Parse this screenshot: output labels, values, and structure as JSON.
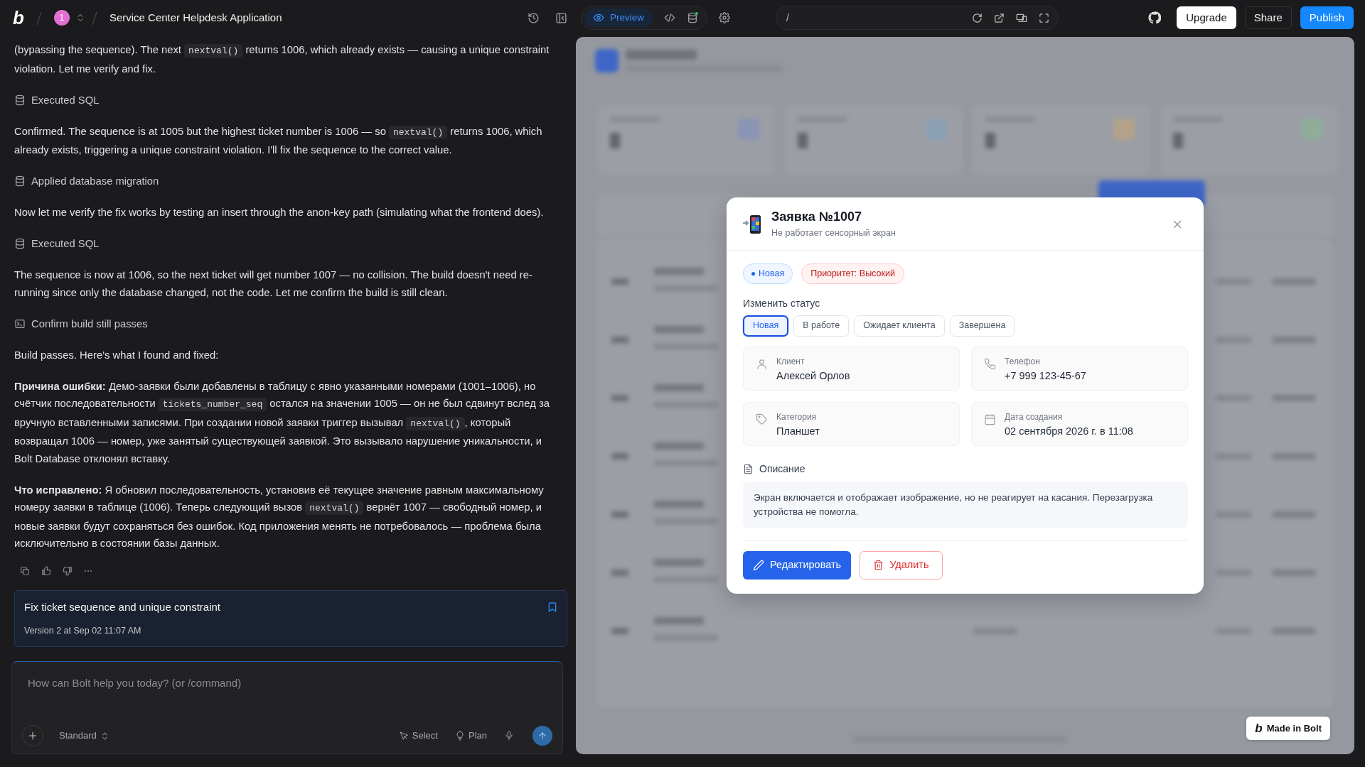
{
  "top_bar": {
    "logo": "b",
    "project_badge": "1",
    "title": "Service Center Helpdesk Application",
    "preview_tab": "Preview",
    "url": "/",
    "buttons": [
      {
        "kind": "light",
        "label": "Upgrade"
      },
      {
        "kind": "dark",
        "label": "Share"
      },
      {
        "kind": "primary",
        "label": "Publish"
      }
    ]
  },
  "chat": {
    "messages": [
      {
        "kind": "text",
        "parts": [
          {
            "kind": "text",
            "text": "(bypassing the sequence). The next "
          },
          {
            "kind": "code",
            "text": "nextval()"
          },
          {
            "kind": "text",
            "text": " returns 1006, which already exists — causing a unique constraint violation. Let me verify and fix."
          }
        ]
      },
      {
        "kind": "db-step",
        "label": "Executed SQL"
      },
      {
        "kind": "text",
        "parts": [
          {
            "kind": "text",
            "text": "Confirmed. The sequence is at 1005 but the highest ticket number is 1006 — so "
          },
          {
            "kind": "code",
            "text": "nextval()"
          },
          {
            "kind": "text",
            "text": " returns 1006, which already exists, triggering a unique constraint violation. I'll fix the sequence to the correct value."
          }
        ]
      },
      {
        "kind": "db-step",
        "label": "Applied database migration"
      },
      {
        "kind": "text",
        "parts": [
          {
            "kind": "text",
            "text": "Now let me verify the fix works by testing an insert through the anon-key path (simulating what the frontend does)."
          }
        ]
      },
      {
        "kind": "db-step",
        "label": "Executed SQL"
      },
      {
        "kind": "text",
        "parts": [
          {
            "kind": "text",
            "text": "The sequence is now at 1006, so the next ticket will get number 1007 — no collision. The build doesn't need re-running since only the database changed, not the code. Let me confirm the build is still clean."
          }
        ]
      },
      {
        "kind": "terminal-step",
        "label": "Confirm build still passes"
      },
      {
        "kind": "text",
        "parts": [
          {
            "kind": "text",
            "text": "Build passes. Here's what I found and fixed:"
          }
        ]
      },
      {
        "kind": "text",
        "parts": [
          {
            "kind": "text",
            "text": "**Причина ошибки:** Демо-заявки были добавлены в таблицу с явно указанными номерами (1001–1006), но счётчик последовательности "
          },
          {
            "kind": "code",
            "text": "tickets_number_seq"
          },
          {
            "kind": "text",
            "text": " остался на значении 1005 — он не был сдвинут вслед за вручную вставленными записями. При создании новой заявки триггер вызывал "
          },
          {
            "kind": "code",
            "text": "nextval()"
          },
          {
            "kind": "text",
            "text": ", который возвращал 1006 — номер, уже занятый существующей заявкой. Это вызывало нарушение уникальности, и Bolt Database отклонял вставку."
          }
        ]
      },
      {
        "kind": "text",
        "parts": [
          {
            "kind": "text",
            "text": "**Что исправлено:** Я обновил последовательность, установив её текущее значение равным максимальному номеру заявки в таблице (1006). Теперь следующий вызов "
          },
          {
            "kind": "code",
            "text": "nextval()"
          },
          {
            "kind": "text",
            "text": " вернёт 1007 — свободный номер, и новые заявки будут сохраняться без ошибок. Код приложения менять не потребовалось — проблема была исключительно в состоянии базы данных."
          }
        ]
      }
    ],
    "version_card": {
      "title": "Fix ticket sequence and unique constraint",
      "subtitle": "Version 2 at Sep 02 11:07 AM"
    },
    "composer": {
      "placeholder": "How can Bolt help you today? (or /command)",
      "mode": "Standard",
      "select": "Select",
      "plan": "Plan"
    }
  },
  "preview": {
    "modal": {
      "title": "Заявка №1007",
      "subtitle": "Не работает сенсорный экран",
      "status_badge": "Новая",
      "priority_badge": "Приоритет: Высокий",
      "status_label": "Изменить статус",
      "status_options": [
        {
          "label": "Новая",
          "selected": true
        },
        {
          "label": "В работе",
          "selected": false
        },
        {
          "label": "Ожидает клиента",
          "selected": false
        },
        {
          "label": "Завершена",
          "selected": false
        }
      ],
      "fields": [
        {
          "kind": "person",
          "label": "Клиент",
          "value": "Алексей Орлов"
        },
        {
          "kind": "phone",
          "label": "Телефон",
          "value": "+7 999 123-45-67"
        },
        {
          "kind": "tag",
          "label": "Категория",
          "value": "Планшет"
        },
        {
          "kind": "calendar",
          "label": "Дата создания",
          "value": "02 сентября 2026 г. в 11:08"
        }
      ],
      "description_label": "Описание",
      "description": "Экран включается и отображает изображение, но не реагирует на касания. Перезагрузка устройства не помогла.",
      "edit_button": "Редактировать",
      "delete_button": "Удалить"
    },
    "made_in_badge": {
      "logo": "b",
      "text": "Made in Bolt"
    }
  }
}
